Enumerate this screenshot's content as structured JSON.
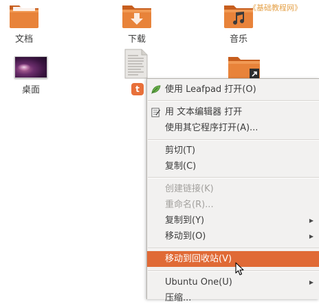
{
  "watermark": "《基础教程网》",
  "desktop": {
    "items": [
      {
        "label": "文档"
      },
      {
        "label": "下载"
      },
      {
        "label": "音乐"
      },
      {
        "label": "桌面"
      }
    ],
    "file_badge": "t"
  },
  "context_menu": {
    "items": [
      {
        "label": "使用 Leafpad 打开(O)"
      },
      {
        "label": "用 文本编辑器 打开"
      },
      {
        "label": "使用其它程序打开(A)..."
      },
      {
        "label": "剪切(T)"
      },
      {
        "label": "复制(C)"
      },
      {
        "label": "创建链接(K)"
      },
      {
        "label": "重命名(R)..."
      },
      {
        "label": "复制到(Y)"
      },
      {
        "label": "移动到(O)"
      },
      {
        "label": "移动到回收站(V)"
      },
      {
        "label": "Ubuntu One(U)"
      },
      {
        "label": "压缩..."
      }
    ],
    "submenu_arrow": "▶"
  },
  "colors": {
    "folder_orange": "#e8833a",
    "highlight": "#e06a36",
    "watermark": "#e5a24a"
  }
}
